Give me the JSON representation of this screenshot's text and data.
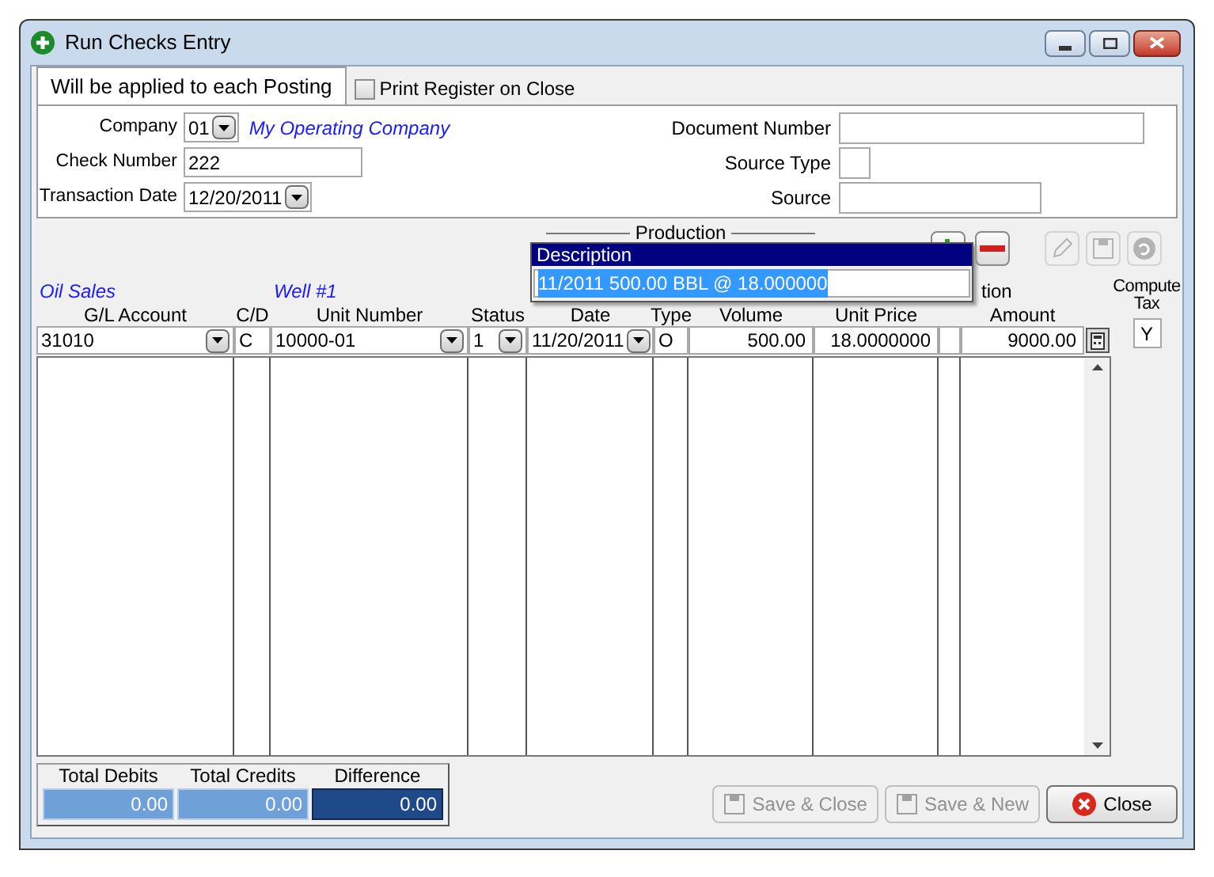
{
  "window": {
    "title": "Run Checks Entry"
  },
  "tab": {
    "label": "Will be applied to each Posting",
    "selected": true
  },
  "print_register": {
    "label": "Print Register on Close",
    "checked": false
  },
  "header_left": [
    {
      "label": "Company",
      "kind": "combo",
      "value": "01",
      "note": "My Operating Company"
    },
    {
      "label": "Check Number",
      "kind": "text",
      "value": "222"
    },
    {
      "label": "Transaction Date",
      "kind": "combo",
      "value": "12/20/2011"
    }
  ],
  "header_right": [
    {
      "label": "Document Number",
      "kind": "wide"
    },
    {
      "label": "Source Type",
      "kind": "narrow"
    },
    {
      "label": "Source",
      "kind": "medium"
    }
  ],
  "production_label": "Production",
  "toolbar": [
    {
      "kind": "add"
    },
    {
      "kind": "remove",
      "disabled": false
    },
    {
      "kind": "edit",
      "disabled": true
    },
    {
      "kind": "save",
      "disabled": true
    },
    {
      "kind": "undo",
      "disabled": true
    }
  ],
  "columns": [
    {
      "caption": "Oil Sales",
      "header": "G/L Account",
      "value": "31010",
      "kind": "combo"
    },
    {
      "header": "C/D",
      "value": "C",
      "kind": "text"
    },
    {
      "caption": "Well #1",
      "header": "Unit Number",
      "value": "10000-01",
      "kind": "combo"
    },
    {
      "header": "Status",
      "value": "1",
      "kind": "combo"
    },
    {
      "header": "Date",
      "value": "11/20/2011",
      "kind": "combo"
    },
    {
      "header": "Type",
      "value": "O",
      "kind": "text"
    },
    {
      "header": "Volume",
      "value": "500.00",
      "kind": "number"
    },
    {
      "header": "Unit Price",
      "value": "18.0000000",
      "kind": "number"
    },
    {
      "kind": "text"
    },
    {
      "caption": "tion",
      "header": "Amount",
      "value": "9000.00",
      "kind": "number"
    }
  ],
  "compute_tax": {
    "header": "Compute Tax",
    "value": "Y"
  },
  "description_popup": {
    "header": "Description",
    "value": "11/2011 500.00 BBL @ 18.000000"
  },
  "totals": [
    {
      "label": "Total Debits",
      "value": "0.00",
      "kind": "light"
    },
    {
      "label": "Total Credits",
      "value": "0.00",
      "kind": "light"
    },
    {
      "label": "Difference",
      "value": "0.00",
      "kind": "dark"
    }
  ],
  "buttons": [
    {
      "label": "Save & Close",
      "kind": "save",
      "disabled": true
    },
    {
      "label": "Save & New",
      "kind": "save",
      "disabled": true
    },
    {
      "label": "Close",
      "kind": "close",
      "disabled": false
    }
  ]
}
